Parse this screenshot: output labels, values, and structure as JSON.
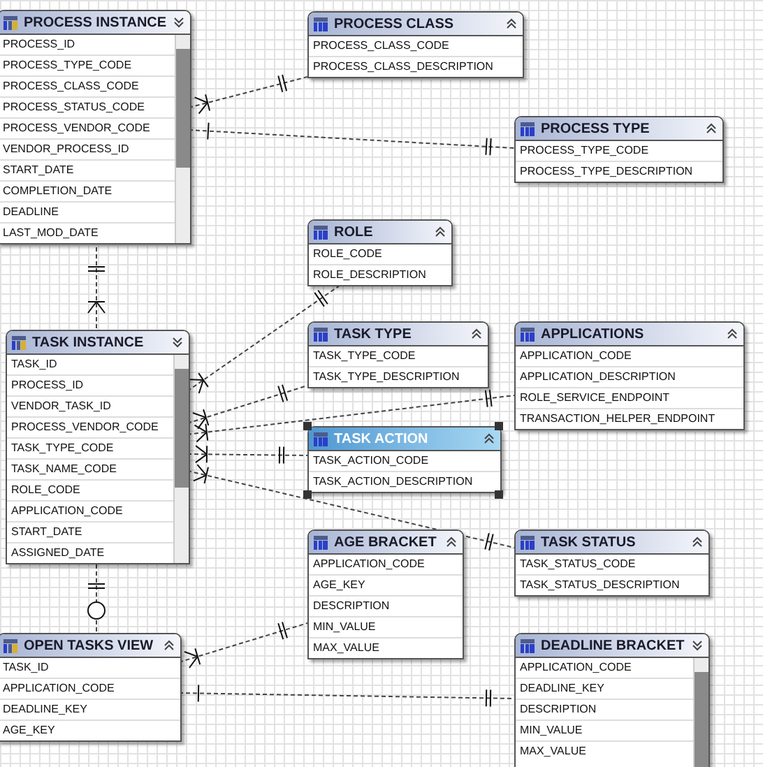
{
  "entities": [
    {
      "name": "PROCESS INSTANCE",
      "kind": "view",
      "selected": false,
      "scrollable": true,
      "columns": [
        "PROCESS_ID",
        "PROCESS_TYPE_CODE",
        "PROCESS_CLASS_CODE",
        "PROCESS_STATUS_CODE",
        "PROCESS_VENDOR_CODE",
        "VENDOR_PROCESS_ID",
        "START_DATE",
        "COMPLETION_DATE",
        "DEADLINE",
        "LAST_MOD_DATE"
      ]
    },
    {
      "name": "PROCESS CLASS",
      "kind": "table",
      "selected": false,
      "scrollable": false,
      "columns": [
        "PROCESS_CLASS_CODE",
        "PROCESS_CLASS_DESCRIPTION"
      ]
    },
    {
      "name": "PROCESS TYPE",
      "kind": "table",
      "selected": false,
      "scrollable": false,
      "columns": [
        "PROCESS_TYPE_CODE",
        "PROCESS_TYPE_DESCRIPTION"
      ]
    },
    {
      "name": "ROLE",
      "kind": "table",
      "selected": false,
      "scrollable": false,
      "columns": [
        "ROLE_CODE",
        "ROLE_DESCRIPTION"
      ]
    },
    {
      "name": "TASK INSTANCE",
      "kind": "view",
      "selected": false,
      "scrollable": true,
      "columns": [
        "TASK_ID",
        "PROCESS_ID",
        "VENDOR_TASK_ID",
        "PROCESS_VENDOR_CODE",
        "TASK_TYPE_CODE",
        "TASK_NAME_CODE",
        "ROLE_CODE",
        "APPLICATION_CODE",
        "START_DATE",
        "ASSIGNED_DATE"
      ]
    },
    {
      "name": "TASK TYPE",
      "kind": "table",
      "selected": false,
      "scrollable": false,
      "columns": [
        "TASK_TYPE_CODE",
        "TASK_TYPE_DESCRIPTION"
      ]
    },
    {
      "name": "APPLICATIONS",
      "kind": "table",
      "selected": false,
      "scrollable": false,
      "columns": [
        "APPLICATION_CODE",
        "APPLICATION_DESCRIPTION",
        "ROLE_SERVICE_ENDPOINT",
        "TRANSACTION_HELPER_ENDPOINT"
      ]
    },
    {
      "name": "TASK ACTION",
      "kind": "table",
      "selected": true,
      "scrollable": false,
      "columns": [
        "TASK_ACTION_CODE",
        "TASK_ACTION_DESCRIPTION"
      ]
    },
    {
      "name": "AGE BRACKET",
      "kind": "table",
      "selected": false,
      "scrollable": false,
      "columns": [
        "APPLICATION_CODE",
        "AGE_KEY",
        "DESCRIPTION",
        "MIN_VALUE",
        "MAX_VALUE"
      ]
    },
    {
      "name": "TASK STATUS",
      "kind": "table",
      "selected": false,
      "scrollable": false,
      "columns": [
        "TASK_STATUS_CODE",
        "TASK_STATUS_DESCRIPTION"
      ]
    },
    {
      "name": "OPEN TASKS VIEW",
      "kind": "view",
      "selected": false,
      "scrollable": false,
      "columns": [
        "TASK_ID",
        "APPLICATION_CODE",
        "DEADLINE_KEY",
        "AGE_KEY"
      ]
    },
    {
      "name": "DEADLINE BRACKET",
      "kind": "table",
      "selected": false,
      "scrollable": true,
      "columns": [
        "APPLICATION_CODE",
        "DEADLINE_KEY",
        "DESCRIPTION",
        "MIN_VALUE",
        "MAX_VALUE"
      ]
    }
  ]
}
